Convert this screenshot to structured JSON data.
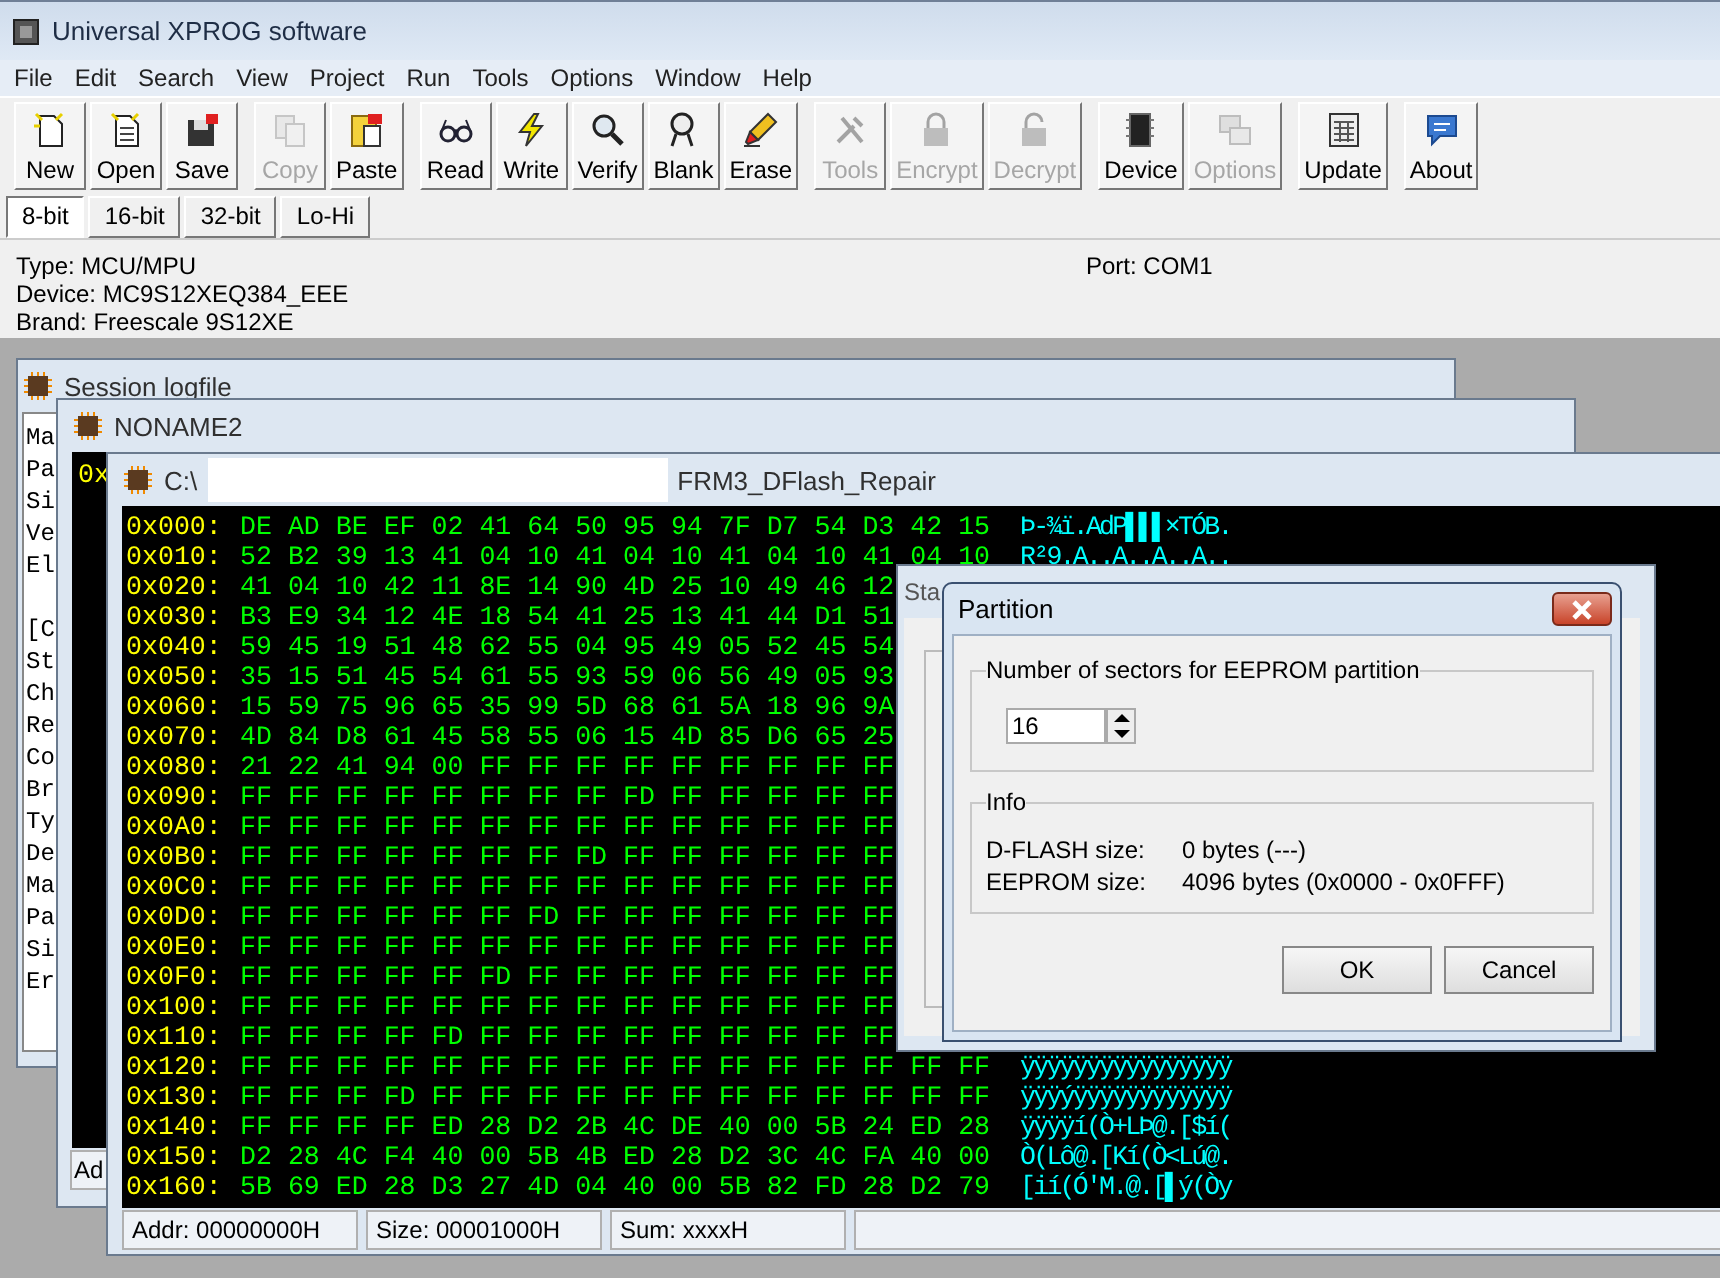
{
  "window": {
    "title": "Universal XPROG software"
  },
  "menu": [
    "File",
    "Edit",
    "Search",
    "View",
    "Project",
    "Run",
    "Tools",
    "Options",
    "Window",
    "Help"
  ],
  "toolbar": {
    "groups": [
      [
        {
          "label": "New",
          "disabled": false
        },
        {
          "label": "Open",
          "disabled": false
        },
        {
          "label": "Save",
          "disabled": false
        }
      ],
      [
        {
          "label": "Copy",
          "disabled": true
        },
        {
          "label": "Paste",
          "disabled": false
        }
      ],
      [
        {
          "label": "Read",
          "disabled": false
        },
        {
          "label": "Write",
          "disabled": false
        },
        {
          "label": "Verify",
          "disabled": false
        },
        {
          "label": "Blank",
          "disabled": false
        },
        {
          "label": "Erase",
          "disabled": false
        }
      ],
      [
        {
          "label": "Tools",
          "disabled": true
        },
        {
          "label": "Encrypt",
          "disabled": true
        },
        {
          "label": "Decrypt",
          "disabled": true
        }
      ],
      [
        {
          "label": "Device",
          "disabled": false
        },
        {
          "label": "Options",
          "disabled": true
        }
      ],
      [
        {
          "label": "Update",
          "disabled": false
        }
      ],
      [
        {
          "label": "About",
          "disabled": false
        }
      ]
    ]
  },
  "view_tabs": [
    {
      "label": "8-bit",
      "selected": true
    },
    {
      "label": "16-bit",
      "selected": false
    },
    {
      "label": "32-bit",
      "selected": false
    },
    {
      "label": "Lo-Hi",
      "selected": false
    }
  ],
  "device_info": {
    "lines": [
      "Type: MCU/MPU",
      "Device: MC9S12XEQ384_EEE",
      "Brand: Freescale 9S12XE"
    ],
    "port": "Port: COM1"
  },
  "session_log": {
    "title": "Session logfile",
    "sections": [
      [
        "Ma",
        "Pa",
        "Si",
        "Ve",
        "El"
      ],
      [
        "[C",
        "St",
        "Ch",
        "Re",
        "Co",
        "Br",
        "Ty",
        "De",
        "Ma",
        "Pa",
        "Si",
        "Er"
      ]
    ]
  },
  "noname_window": {
    "title": "NONAME2",
    "content": "0x",
    "status": "Ad"
  },
  "hex_window": {
    "title_prefix": "C:\\",
    "title_suffix": "FRM3_DFlash_Repair",
    "rows": [
      {
        "address": "0x000:",
        "bytes": "DE AD BE EF 02 41 64 50 95 94 7F D7 54 D3 42 15",
        "ascii": "Þ-¾ï.AdP▌▌▌×TÓB."
      },
      {
        "address": "0x010:",
        "bytes": "52 B2 39 13 41 04 10 41 04 10 41 04 10 41 04 10",
        "ascii": "R²9.A..A..A..A.."
      },
      {
        "address": "0x020:",
        "bytes": "41 04 10 42 11 8E 14 90 4D 25 10 49 46 12"
      },
      {
        "address": "0x030:",
        "bytes": "B3 E9 34 12 4E 18 54 41 25 13 41 44 D1 51"
      },
      {
        "address": "0x040:",
        "bytes": "59 45 19 51 48 62 55 04 95 49 05 52 45 54"
      },
      {
        "address": "0x050:",
        "bytes": "35 15 51 45 54 61 55 93 59 06 56 49 05 93"
      },
      {
        "address": "0x060:",
        "bytes": "15 59 75 96 65 35 99 5D 68 61 5A 18 96 9A"
      },
      {
        "address": "0x070:",
        "bytes": "4D 84 D8 61 45 58 55 06 15 4D 85 D6 65 25"
      },
      {
        "address": "0x080:",
        "bytes": "21 22 41 94 00 FF FF FF FF FF FF FF FF FF"
      },
      {
        "address": "0x090:",
        "bytes": "FF FF FF FF FF FF FF FF FD FF FF FF FF FF"
      },
      {
        "address": "0x0A0:",
        "bytes": "FF FF FF FF FF FF FF FF FF FF FF FF FF FF"
      },
      {
        "address": "0x0B0:",
        "bytes": "FF FF FF FF FF FF FF FD FF FF FF FF FF FF"
      },
      {
        "address": "0x0C0:",
        "bytes": "FF FF FF FF FF FF FF FF FF FF FF FF FF FF"
      },
      {
        "address": "0x0D0:",
        "bytes": "FF FF FF FF FF FF FD FF FF FF FF FF FF FF"
      },
      {
        "address": "0x0E0:",
        "bytes": "FF FF FF FF FF FF FF FF FF FF FF FF FF FF"
      },
      {
        "address": "0x0F0:",
        "bytes": "FF FF FF FF FF FD FF FF FF FF FF FF FF FF"
      },
      {
        "address": "0x100:",
        "bytes": "FF FF FF FF FF FF FF FF FF FF FF FF FF FF"
      },
      {
        "address": "0x110:",
        "bytes": "FF FF FF FF FD FF FF FF FF FF FF FF FF FF"
      },
      {
        "address": "0x120:",
        "bytes": "FF FF FF FF FF FF FF FF FF FF FF FF FF FF FF FF",
        "ascii": "ÿÿÿÿÿÿÿÿÿÿÿÿÿÿÿÿ"
      },
      {
        "address": "0x130:",
        "bytes": "FF FF FF FD FF FF FF FF FF FF FF FF FF FF FF FF",
        "ascii": "ÿÿÿýÿÿÿÿÿÿÿÿÿÿÿÿ"
      },
      {
        "address": "0x140:",
        "bytes": "FF FF FF FF ED 28 D2 2B 4C DE 40 00 5B 24 ED 28",
        "ascii": "ÿÿÿÿí(Ò+LÞ@.[$í("
      },
      {
        "address": "0x150:",
        "bytes": "D2 28 4C F4 40 00 5B 4B ED 28 D2 3C 4C FA 40 00",
        "ascii": "Ò(Lô@.[Kí(Ò<Lú@."
      },
      {
        "address": "0x160:",
        "bytes": "5B 69 ED 28 D3 27 4D 04 40 00 5B 82 FD 28 D2 79",
        "ascii": "[ií(Ó'M.@.[▌ý(Òy"
      }
    ],
    "status_bar": [
      "Addr: 00000000H",
      "Size: 00001000H",
      "Sum: xxxxH"
    ]
  },
  "status_window": {
    "title": "Sta"
  },
  "dialog": {
    "title": "Partition",
    "sectors_group": "Number of sectors for EEPROM partition",
    "sectors_value": "16",
    "info_group": "Info",
    "info_rows": [
      {
        "label": "D-FLASH size:",
        "value": "0 bytes (---)"
      },
      {
        "label": "EEPROM size:",
        "value": "4096 bytes (0x0000 - 0x0FFF)"
      }
    ],
    "buttons": [
      "OK",
      "Cancel"
    ]
  }
}
